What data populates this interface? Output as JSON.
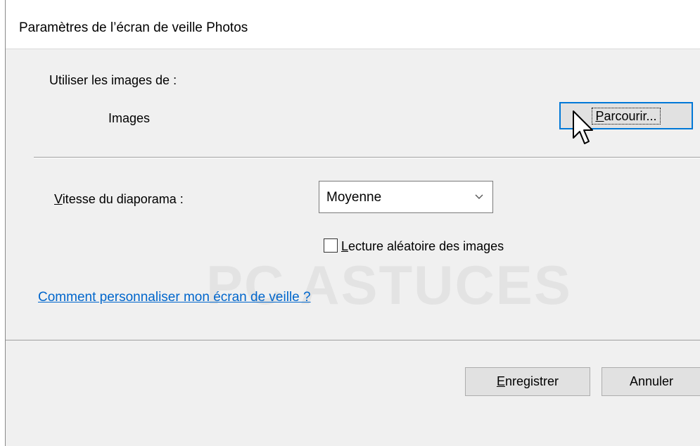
{
  "dialog": {
    "title": "Paramètres de l’écran de veille Photos"
  },
  "source": {
    "label": "Utiliser les images de :",
    "folder": "Images",
    "browse_button": {
      "prefix": "P",
      "rest": "arcourir..."
    }
  },
  "slideshow": {
    "speed_label": {
      "prefix": "V",
      "rest": "itesse du diaporama :"
    },
    "speed_value": "Moyenne",
    "shuffle": {
      "prefix": "L",
      "rest": "ecture aléatoire des images",
      "checked": false
    }
  },
  "help_link": "Comment personnaliser mon écran de veille ?",
  "footer": {
    "save_button": {
      "prefix": "E",
      "rest": "nregistrer"
    },
    "cancel_button": "Annuler"
  },
  "watermark": "PC ASTUCES",
  "colors": {
    "accent": "#0078d7",
    "link": "#0066cc",
    "dialog_bg": "#f0f0f0"
  }
}
